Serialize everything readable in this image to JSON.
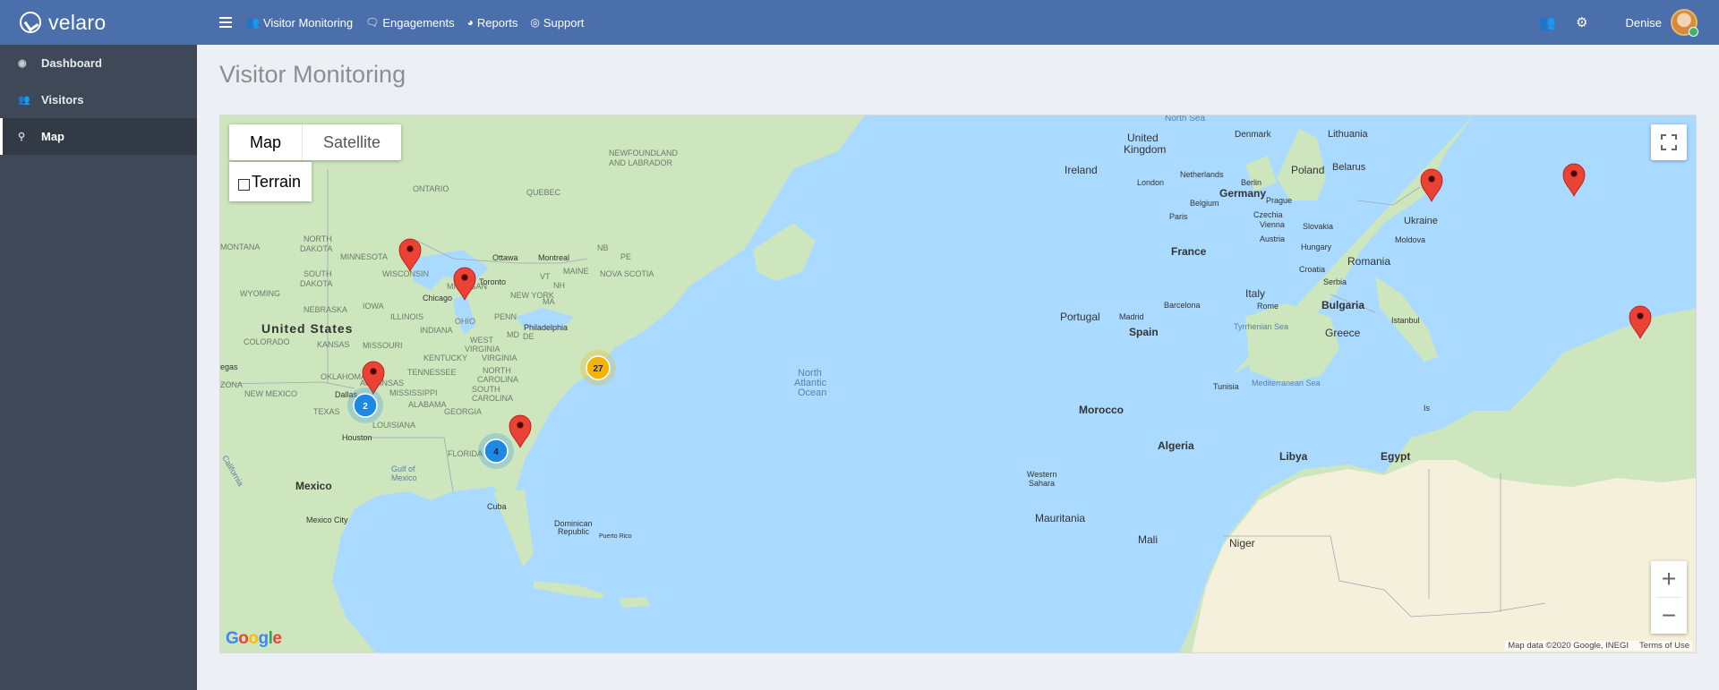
{
  "app": {
    "brand": "velaro"
  },
  "topnav": {
    "items": [
      {
        "label": "Visitor Monitoring",
        "icon": "users-icon"
      },
      {
        "label": "Engagements",
        "icon": "comment-icon"
      },
      {
        "label": "Reports",
        "icon": "pie-chart-icon"
      },
      {
        "label": "Support",
        "icon": "life-ring-icon"
      }
    ],
    "user": {
      "name": "Denise"
    }
  },
  "sidebar": {
    "items": [
      {
        "label": "Dashboard",
        "icon": "dashboard-icon"
      },
      {
        "label": "Visitors",
        "icon": "users-icon"
      },
      {
        "label": "Map",
        "icon": "map-marker-icon",
        "active": true
      }
    ]
  },
  "page": {
    "title": "Visitor Monitoring"
  },
  "map": {
    "type_controls": {
      "map": "Map",
      "satellite": "Satellite",
      "terrain": "Terrain"
    },
    "zoom_in": "+",
    "zoom_out": "−",
    "logo": "Google",
    "attribution": "Map data ©2020 Google, INEGI",
    "terms": "Terms of Use",
    "clusters": [
      {
        "count": "27",
        "color": "#f4b400"
      },
      {
        "count": "2",
        "color": "#1e88e5"
      },
      {
        "count": "4",
        "color": "#1e88e5"
      }
    ],
    "labels": {
      "north_sea": "North Sea",
      "united_kingdom": [
        "United",
        "Kingdom"
      ],
      "denmark": "Denmark",
      "lithuania": "Lithuania",
      "newfoundland": [
        "NEWFOUNDLAND",
        "AND LABRADOR"
      ],
      "ireland": "Ireland",
      "netherlands": "Netherlands",
      "poland": "Poland",
      "belarus": "Belarus",
      "london": "London",
      "berlin": "Berlin",
      "ontario": "ONTARIO",
      "quebec": "QUEBEC",
      "belgium": "Belgium",
      "germany": "Germany",
      "prague": "Prague",
      "paris": "Paris",
      "czechia": "Czechia",
      "ukraine": "Ukraine",
      "vienna": "Vienna",
      "slovakia": "Slovakia",
      "north_dakota": [
        "NORTH",
        "DAKOTA"
      ],
      "montana": "MONTANA",
      "austria": "Austria",
      "hungary": "Hungary",
      "moldova": "Moldova",
      "nb": "NB",
      "pe": "PE",
      "minnesota": "MINNESOTA",
      "ottawa": "Ottawa",
      "montreal": "Montreal",
      "france": "France",
      "romania": "Romania",
      "wisconsin": "WISCONSIN",
      "south_dakota": [
        "SOUTH",
        "DAKOTA"
      ],
      "vt": "VT",
      "maine": "MAINE",
      "nova_scotia": "NOVA SCOTIA",
      "croatia": "Croatia",
      "michigan": "MICHIGAN",
      "toronto": "Toronto",
      "nh": "NH",
      "wyoming": "WYOMING",
      "new_york": "NEW YORK",
      "serbia": "Serbia",
      "chicago": "Chicago",
      "ma": "MA",
      "nebraska": "NEBRASKA",
      "iowa": "IOWA",
      "barcelona": "Barcelona",
      "italy": "Italy",
      "bulgaria": "Bulgaria",
      "rome": "Rome",
      "portugal": "Portugal",
      "madrid": "Madrid",
      "illinois": "ILLINOIS",
      "penn": "PENN",
      "ohio": "OHIO",
      "philadelphia": "Philadelphia",
      "istanbul": "Istanbul",
      "spain": "Spain",
      "united_states": "United States",
      "tyrrhenian": "Tyrrhenian Sea",
      "greece": "Greece",
      "de": "DE",
      "indiana": "INDIANA",
      "md": "MD",
      "colorado": "COLORADO",
      "kansas": "KANSAS",
      "missouri": "MISSOURI",
      "west_virginia": [
        "WEST",
        "VIRGINIA"
      ],
      "kentucky": "KENTUCKY",
      "virginia": "VIRGINIA",
      "north_atlantic": [
        "North",
        "Atlantic",
        "Ocean"
      ],
      "tennessee": "TENNESSEE",
      "north_carolina": [
        "NORTH",
        "CAROLINA"
      ],
      "vegas": "egas",
      "oklahoma": "OKLAHOMA",
      "mediterranean": "Mediterranean Sea",
      "arkansas": "ARKANSAS",
      "mississippi": "MISSISSIPPI",
      "south_carolina": [
        "SOUTH",
        "CAROLINA"
      ],
      "tunisia": "Tunisia",
      "zona": "ZONA",
      "new_mexico": "NEW MEXICO",
      "alabama": "ALABAMA",
      "dallas": "Dallas",
      "texas": "TEXAS",
      "georgia": "GEORGIA",
      "morocco": "Morocco",
      "louisiana": "LOUISIANA",
      "houston": "Houston",
      "algeria": "Algeria",
      "libya": "Libya",
      "egypt": "Egypt",
      "florida": "FLORIDA",
      "california": "California",
      "gulf_of_mexico": [
        "Gulf of",
        "Mexico"
      ],
      "western_sahara": [
        "Western",
        "Sahara"
      ],
      "mexico": "Mexico",
      "cuba": "Cuba",
      "mauritania": "Mauritania",
      "mexico_city": "Mexico City",
      "dominican_republic": [
        "Dominican",
        "Republic"
      ],
      "mali": "Mali",
      "niger": "Niger",
      "puerto_rico": "Puerto Rico",
      "is": "Is"
    }
  },
  "colors": {
    "topbar": "#4a6fab",
    "sidebar": "#3e4856",
    "water": "#aadaff",
    "land_green": "#cde6bd",
    "land_desert": "#f5f0dc",
    "marker": "#ea4335"
  }
}
